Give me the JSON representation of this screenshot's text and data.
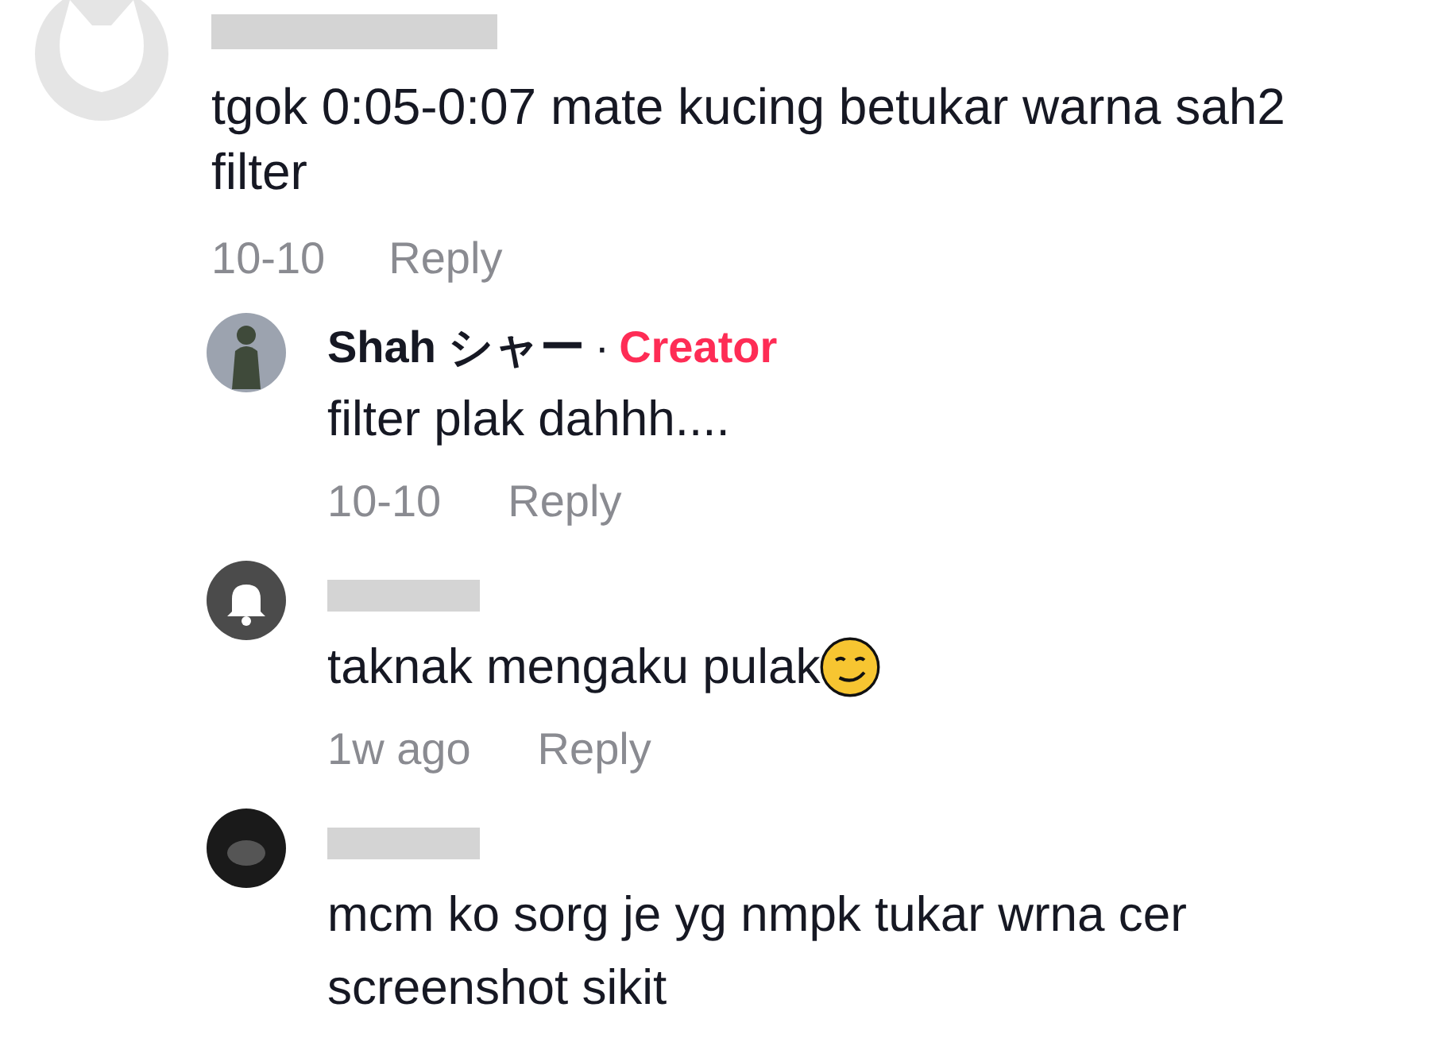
{
  "comment": {
    "avatar": {
      "kind": "cat"
    },
    "name_redacted": true,
    "text": "tgok 0:05-0:07 mate kucing betukar warna sah2 filter",
    "date": "10-10",
    "reply_label": "Reply"
  },
  "replies": [
    {
      "avatar": {
        "kind": "figure"
      },
      "name_redacted": false,
      "author": "Shah シャー",
      "separator": "·",
      "badge": "Creator",
      "text": "filter plak dahhh....",
      "emoji": false,
      "date": "10-10",
      "reply_label": "Reply"
    },
    {
      "avatar": {
        "kind": "bell"
      },
      "name_redacted": true,
      "text": "taknak mengaku pulak",
      "emoji": true,
      "date": "1w ago",
      "reply_label": "Reply"
    },
    {
      "avatar": {
        "kind": "dark"
      },
      "name_redacted": true,
      "text": "mcm ko sorg je yg nmpk tukar wrna cer screenshot sikit",
      "emoji": false
    }
  ]
}
